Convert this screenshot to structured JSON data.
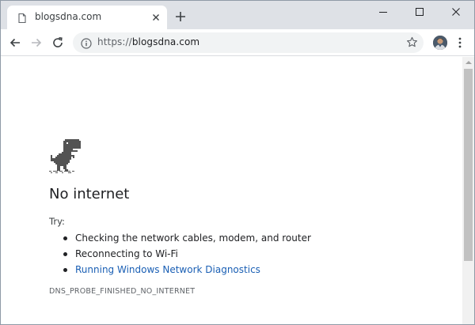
{
  "tab": {
    "title": "blogsdna.com",
    "favicon_icon": "page-icon",
    "close_icon": "close-icon"
  },
  "new_tab_icon": "plus-icon",
  "window_controls": [
    "minimize-icon",
    "maximize-icon",
    "close-icon"
  ],
  "toolbar": {
    "back_icon": "arrow-left-icon",
    "forward_icon": "arrow-right-icon",
    "reload_icon": "reload-icon",
    "omnibox": {
      "security_icon": "info-icon",
      "url_scheme": "https://",
      "url_host": "blogsdna.com",
      "bookmark_icon": "star-icon"
    },
    "profile_icon": "avatar",
    "menu_icon": "kebab-menu-icon"
  },
  "error_page": {
    "illustration": "dinosaur-icon",
    "heading": "No internet",
    "try_label": "Try:",
    "suggestions": [
      "Checking the network cables, modem, and router",
      "Reconnecting to Wi-Fi",
      "Running Windows Network Diagnostics"
    ],
    "error_code": "DNS_PROBE_FINISHED_NO_INTERNET"
  },
  "colors": {
    "tabstrip": "#dee1e6",
    "omnibox": "#f1f3f4",
    "link": "#1a5fb4",
    "text": "#202124",
    "secondary_text": "#5f6368"
  }
}
